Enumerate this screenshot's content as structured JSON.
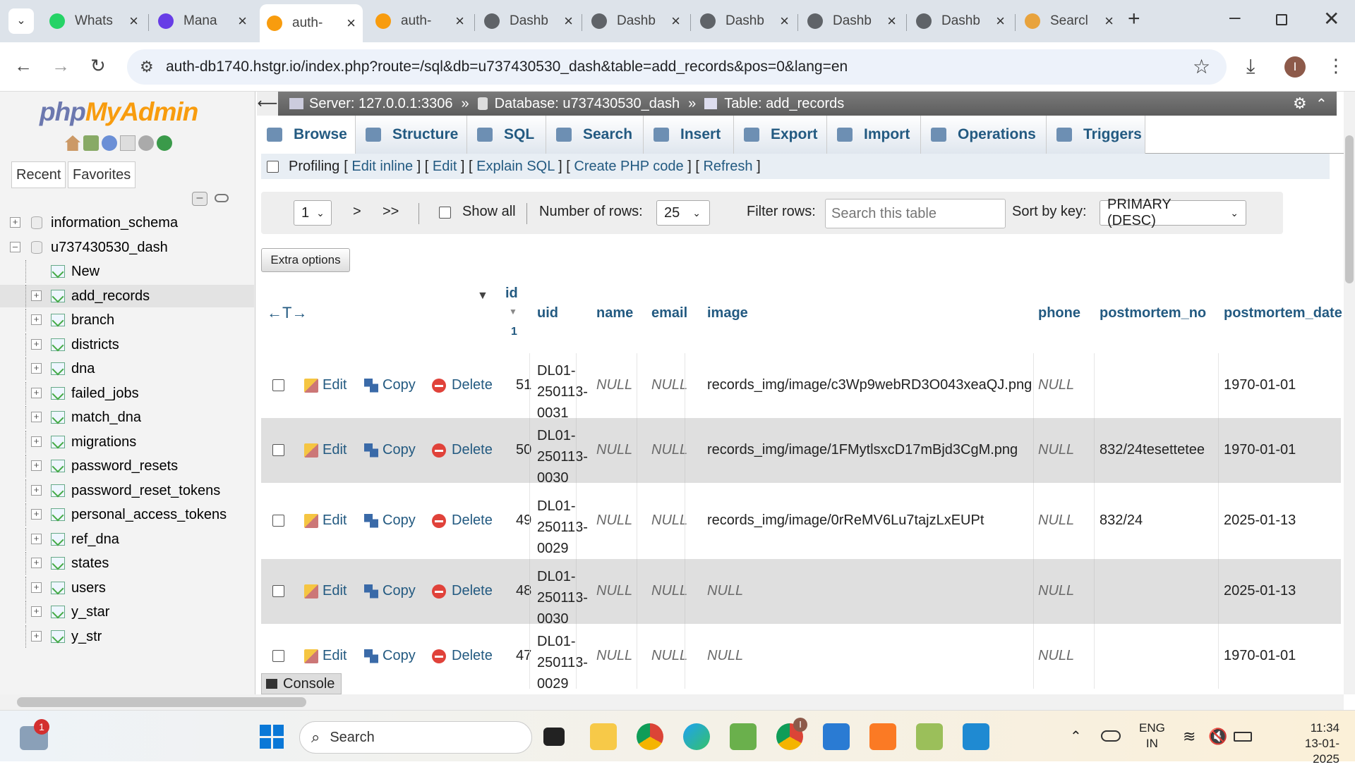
{
  "browser": {
    "tabs": [
      {
        "label": "Whats",
        "icon": "whatsapp-icon",
        "color": "#25d366"
      },
      {
        "label": "Mana",
        "icon": "hostinger-icon",
        "color": "#673de6"
      },
      {
        "label": "auth-",
        "icon": "phpmyadmin-icon",
        "color": "#f89c0e",
        "active": true
      },
      {
        "label": "auth-",
        "icon": "phpmyadmin-icon",
        "color": "#f89c0e"
      },
      {
        "label": "Dashb",
        "icon": "globe-icon",
        "color": "#5f6368"
      },
      {
        "label": "Dashb",
        "icon": "globe-icon",
        "color": "#5f6368"
      },
      {
        "label": "Dashb",
        "icon": "globe-icon",
        "color": "#5f6368"
      },
      {
        "label": "Dashb",
        "icon": "globe-icon",
        "color": "#5f6368"
      },
      {
        "label": "Dashb",
        "icon": "globe-icon",
        "color": "#5f6368"
      },
      {
        "label": "Searcl",
        "icon": "search-person-icon",
        "color": "#e8a33d"
      }
    ],
    "url": "auth-db1740.hstgr.io/index.php?route=/sql&db=u737430530_dash&table=add_records&pos=0&lang=en",
    "profile_initial": "I"
  },
  "sidebar": {
    "logo_a": "php",
    "logo_b": "MyAdmin",
    "recent": "Recent",
    "favorites": "Favorites",
    "tree": [
      {
        "label": "information_schema",
        "level": 0,
        "type": "db"
      },
      {
        "label": "u737430530_dash",
        "level": 0,
        "type": "db",
        "expanded": true
      },
      {
        "label": "New",
        "level": 1,
        "type": "new"
      },
      {
        "label": "add_records",
        "level": 1,
        "type": "table",
        "selected": true
      },
      {
        "label": "branch",
        "level": 1,
        "type": "table"
      },
      {
        "label": "districts",
        "level": 1,
        "type": "table"
      },
      {
        "label": "dna",
        "level": 1,
        "type": "table"
      },
      {
        "label": "failed_jobs",
        "level": 1,
        "type": "table"
      },
      {
        "label": "match_dna",
        "level": 1,
        "type": "table"
      },
      {
        "label": "migrations",
        "level": 1,
        "type": "table"
      },
      {
        "label": "password_resets",
        "level": 1,
        "type": "table"
      },
      {
        "label": "password_reset_tokens",
        "level": 1,
        "type": "table"
      },
      {
        "label": "personal_access_tokens",
        "level": 1,
        "type": "table"
      },
      {
        "label": "ref_dna",
        "level": 1,
        "type": "table"
      },
      {
        "label": "states",
        "level": 1,
        "type": "table"
      },
      {
        "label": "users",
        "level": 1,
        "type": "table"
      },
      {
        "label": "y_star",
        "level": 1,
        "type": "table"
      },
      {
        "label": "y_str",
        "level": 1,
        "type": "table"
      }
    ]
  },
  "breadcrumb": {
    "server": "Server: 127.0.0.1:3306",
    "database": "Database: u737430530_dash",
    "table": "Table: add_records",
    "sep": "»"
  },
  "menu": [
    "Browse",
    "Structure",
    "SQL",
    "Search",
    "Insert",
    "Export",
    "Import",
    "Operations",
    "Triggers"
  ],
  "profiling": {
    "label": "Profiling",
    "links": [
      "Edit inline",
      "Edit",
      "Explain SQL",
      "Create PHP code",
      "Refresh"
    ]
  },
  "nav": {
    "page": "1",
    "next": ">",
    "last": ">>",
    "show_all": "Show all",
    "rows_label": "Number of rows:",
    "rows_value": "25",
    "filter_label": "Filter rows:",
    "filter_placeholder": "Search this table",
    "sort_label": "Sort by key:",
    "sort_value": "PRIMARY (DESC)"
  },
  "extra_options": "Extra options",
  "table": {
    "columns": [
      "id",
      "uid",
      "name",
      "email",
      "image",
      "phone",
      "postmortem_no",
      "postmortem_date"
    ],
    "sort_index": "1",
    "actions": {
      "edit": "Edit",
      "copy": "Copy",
      "delete": "Delete"
    },
    "rows": [
      {
        "id": "51",
        "uid": [
          "DL01-",
          "250113-",
          "0031"
        ],
        "name": "NULL",
        "email": "NULL",
        "image": "records_img/image/c3Wp9webRD3O043xeaQJ.png",
        "image_null": false,
        "phone": "NULL",
        "postmortem_no": "",
        "postmortem_date": "1970-01-01"
      },
      {
        "id": "50",
        "uid": [
          "DL01-",
          "250113-",
          "0030"
        ],
        "name": "NULL",
        "email": "NULL",
        "image": "records_img/image/1FMytlsxcD17mBjd3CgM.png",
        "image_null": false,
        "phone": "NULL",
        "postmortem_no": "832/24tesettetee",
        "postmortem_date": "1970-01-01"
      },
      {
        "id": "49",
        "uid": [
          "DL01-",
          "250113-",
          "0029"
        ],
        "name": "NULL",
        "email": "NULL",
        "image": "records_img/image/0rReMV6Lu7tajzLxEUPt",
        "image_null": false,
        "phone": "NULL",
        "postmortem_no": "832/24",
        "postmortem_date": "2025-01-13"
      },
      {
        "id": "48",
        "uid": [
          "DL01-",
          "250113-",
          "0030"
        ],
        "name": "NULL",
        "email": "NULL",
        "image": "NULL",
        "image_null": true,
        "phone": "NULL",
        "postmortem_no": "",
        "postmortem_date": "2025-01-13"
      },
      {
        "id": "47",
        "uid": [
          "DL01-",
          "250113-",
          "0029"
        ],
        "name": "NULL",
        "email": "NULL",
        "image": "NULL",
        "image_null": true,
        "phone": "NULL",
        "postmortem_no": "",
        "postmortem_date": "1970-01-01"
      }
    ]
  },
  "console": "Console",
  "taskbar": {
    "search": "Search",
    "notification_count": "1",
    "chrome_badge": "I",
    "lang_top": "ENG",
    "lang_bottom": "IN",
    "time": "11:34",
    "date": "13-01-2025"
  }
}
